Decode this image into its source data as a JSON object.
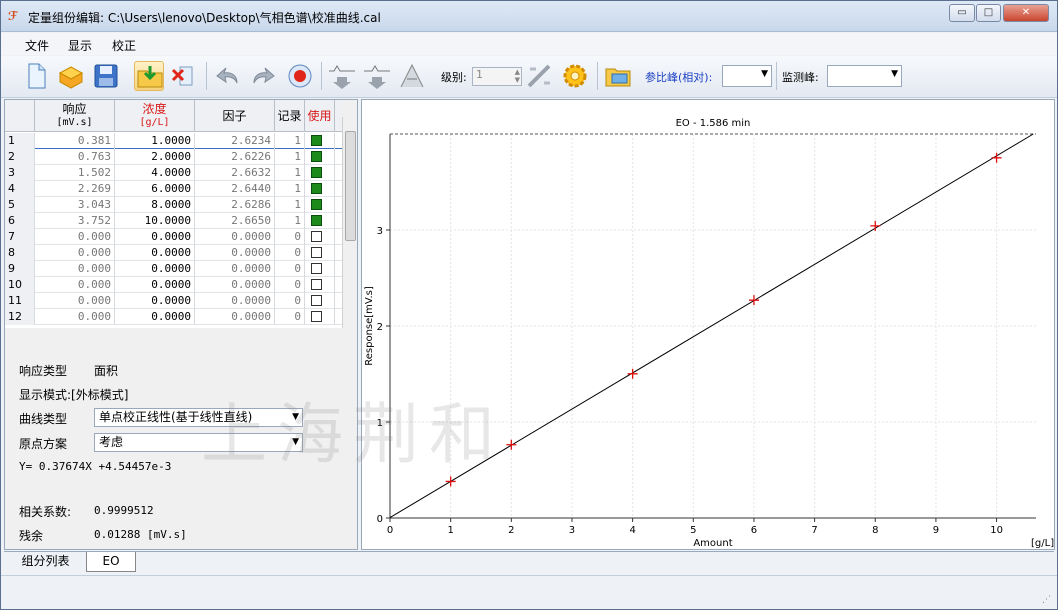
{
  "window": {
    "title": "定量组份编辑: C:\\Users\\lenovo\\Desktop\\气相色谱\\校准曲线.cal",
    "min_glyph": "▭",
    "max_glyph": "□",
    "close_glyph": "✕"
  },
  "menu": {
    "items": [
      "文件",
      "显示",
      "校正"
    ]
  },
  "toolbar": {
    "level_label": "级别:",
    "level_value": "1",
    "ref_peak_label": "参比峰(相对):",
    "ref_peak_value": "",
    "monitor_peak_label": "监测峰:",
    "monitor_peak_value": "",
    "icons": [
      "new-file-icon",
      "open-box-icon",
      "save-icon",
      "import-folder-icon",
      "delete-icon",
      "undo-icon",
      "redo-icon",
      "record-icon",
      "peak-down-icon",
      "peak-down-icon",
      "peak-icon",
      "erase-icon",
      "gear-icon",
      "folder-chart-icon"
    ]
  },
  "grid": {
    "headers": {
      "response": "响应",
      "response_unit": "[mV.s]",
      "concentration": "浓度",
      "concentration_unit": "[g/L]",
      "factor": "因子",
      "records": "记录",
      "use": "使用"
    },
    "rows": [
      {
        "idx": "1",
        "response": "0.381",
        "conc": "1.0000",
        "factor": "2.6234",
        "rec": "1",
        "use": true
      },
      {
        "idx": "2",
        "response": "0.763",
        "conc": "2.0000",
        "factor": "2.6226",
        "rec": "1",
        "use": true
      },
      {
        "idx": "3",
        "response": "1.502",
        "conc": "4.0000",
        "factor": "2.6632",
        "rec": "1",
        "use": true
      },
      {
        "idx": "4",
        "response": "2.269",
        "conc": "6.0000",
        "factor": "2.6440",
        "rec": "1",
        "use": true
      },
      {
        "idx": "5",
        "response": "3.043",
        "conc": "8.0000",
        "factor": "2.6286",
        "rec": "1",
        "use": true
      },
      {
        "idx": "6",
        "response": "3.752",
        "conc": "10.0000",
        "factor": "2.6650",
        "rec": "1",
        "use": true
      },
      {
        "idx": "7",
        "response": "0.000",
        "conc": "0.0000",
        "factor": "0.0000",
        "rec": "0",
        "use": false
      },
      {
        "idx": "8",
        "response": "0.000",
        "conc": "0.0000",
        "factor": "0.0000",
        "rec": "0",
        "use": false
      },
      {
        "idx": "9",
        "response": "0.000",
        "conc": "0.0000",
        "factor": "0.0000",
        "rec": "0",
        "use": false
      },
      {
        "idx": "10",
        "response": "0.000",
        "conc": "0.0000",
        "factor": "0.0000",
        "rec": "0",
        "use": false
      },
      {
        "idx": "11",
        "response": "0.000",
        "conc": "0.0000",
        "factor": "0.0000",
        "rec": "0",
        "use": false
      },
      {
        "idx": "12",
        "response": "0.000",
        "conc": "0.0000",
        "factor": "0.0000",
        "rec": "0",
        "use": false
      }
    ]
  },
  "info": {
    "response_type_label": "响应类型",
    "response_type_value": "面积",
    "display_mode": "显示模式:[外标模式]",
    "curve_type_label": "曲线类型",
    "curve_type_value": "单点校正线性(基于线性直线)",
    "origin_label": "原点方案",
    "origin_value": "考虑",
    "equation": "Y= 0.37674X +4.54457e-3",
    "correlation_label": "相关系数:",
    "correlation_value": "0.9999512",
    "residual_label": "残余",
    "residual_value": "0.01288 [mV.s]"
  },
  "tabs": [
    "组分列表",
    "EO"
  ],
  "watermark": "上海荆和",
  "chart_data": {
    "type": "scatter",
    "title": "EO - 1.586 min",
    "xlabel": "Amount",
    "ylabel": "Response[mV.s]",
    "x_unit": "[g/L]",
    "xlim": [
      0,
      10.65
    ],
    "ylim": [
      0,
      4.0
    ],
    "xticks": [
      0,
      1,
      2,
      3,
      4,
      5,
      6,
      7,
      8,
      9,
      10
    ],
    "yticks": [
      0,
      1,
      2,
      3
    ],
    "grid": true,
    "point_color": "#e01010",
    "line_color": "#000000",
    "points": [
      {
        "x": 1,
        "y": 0.381
      },
      {
        "x": 2,
        "y": 0.763
      },
      {
        "x": 4,
        "y": 1.502
      },
      {
        "x": 6,
        "y": 2.269
      },
      {
        "x": 8,
        "y": 3.043
      },
      {
        "x": 10,
        "y": 3.752
      }
    ],
    "fit": {
      "slope": 0.37674,
      "intercept": 0.00454457
    }
  }
}
